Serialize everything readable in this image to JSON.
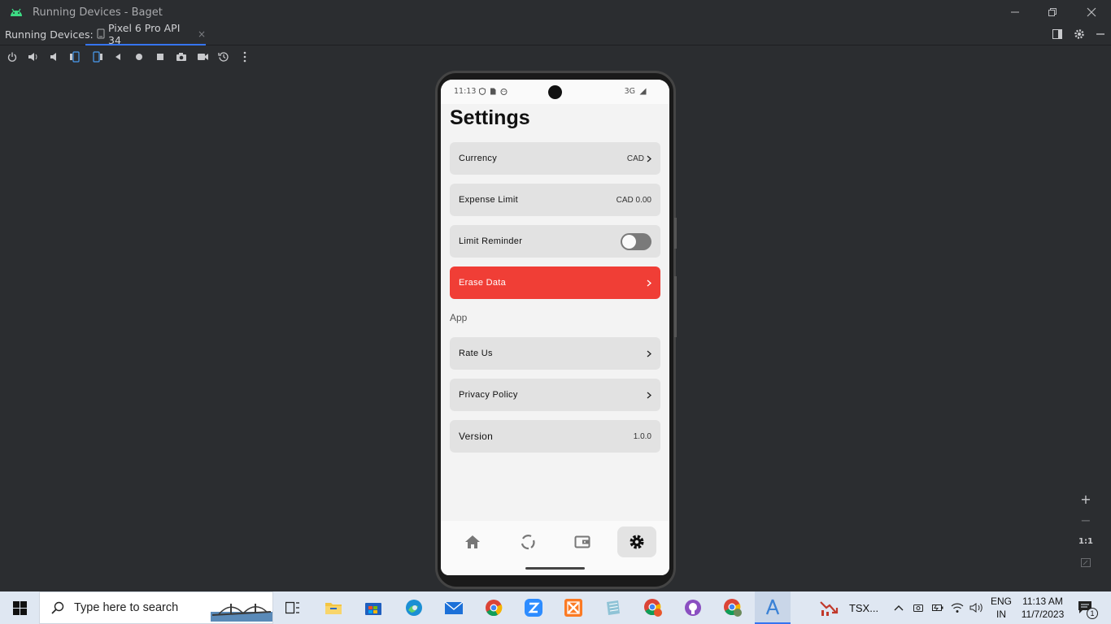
{
  "window": {
    "title": "Running Devices - Baget"
  },
  "tabs": {
    "label": "Running Devices:",
    "device_tab": "Pixel 6 Pro API 34",
    "close": "×"
  },
  "status_bar": {
    "time": "11:13",
    "network": "3G"
  },
  "settings": {
    "title": "Settings",
    "currency": {
      "label": "Currency",
      "value": "CAD"
    },
    "expense_limit": {
      "label": "Expense Limit",
      "value": "CAD 0.00"
    },
    "limit_reminder": {
      "label": "Limit Reminder",
      "enabled": false
    },
    "erase": {
      "label": "Erase Data"
    },
    "section_app": "App",
    "rate": {
      "label": "Rate Us"
    },
    "privacy": {
      "label": "Privacy Policy"
    },
    "version": {
      "label": "Version",
      "value": "1.0.0"
    }
  },
  "zoom": {
    "plus": "+",
    "minus": "−",
    "one_to_one": "1:1"
  },
  "taskbar": {
    "search_placeholder": "Type here to search",
    "stock_label": "TSX...",
    "lang_top": "ENG",
    "lang_bottom": "IN",
    "time": "11:13 AM",
    "date": "11/7/2023",
    "notification_count": "1"
  },
  "colors": {
    "accent": "#3574f0",
    "danger": "#f03e36",
    "android_green": "#3ddc84"
  }
}
